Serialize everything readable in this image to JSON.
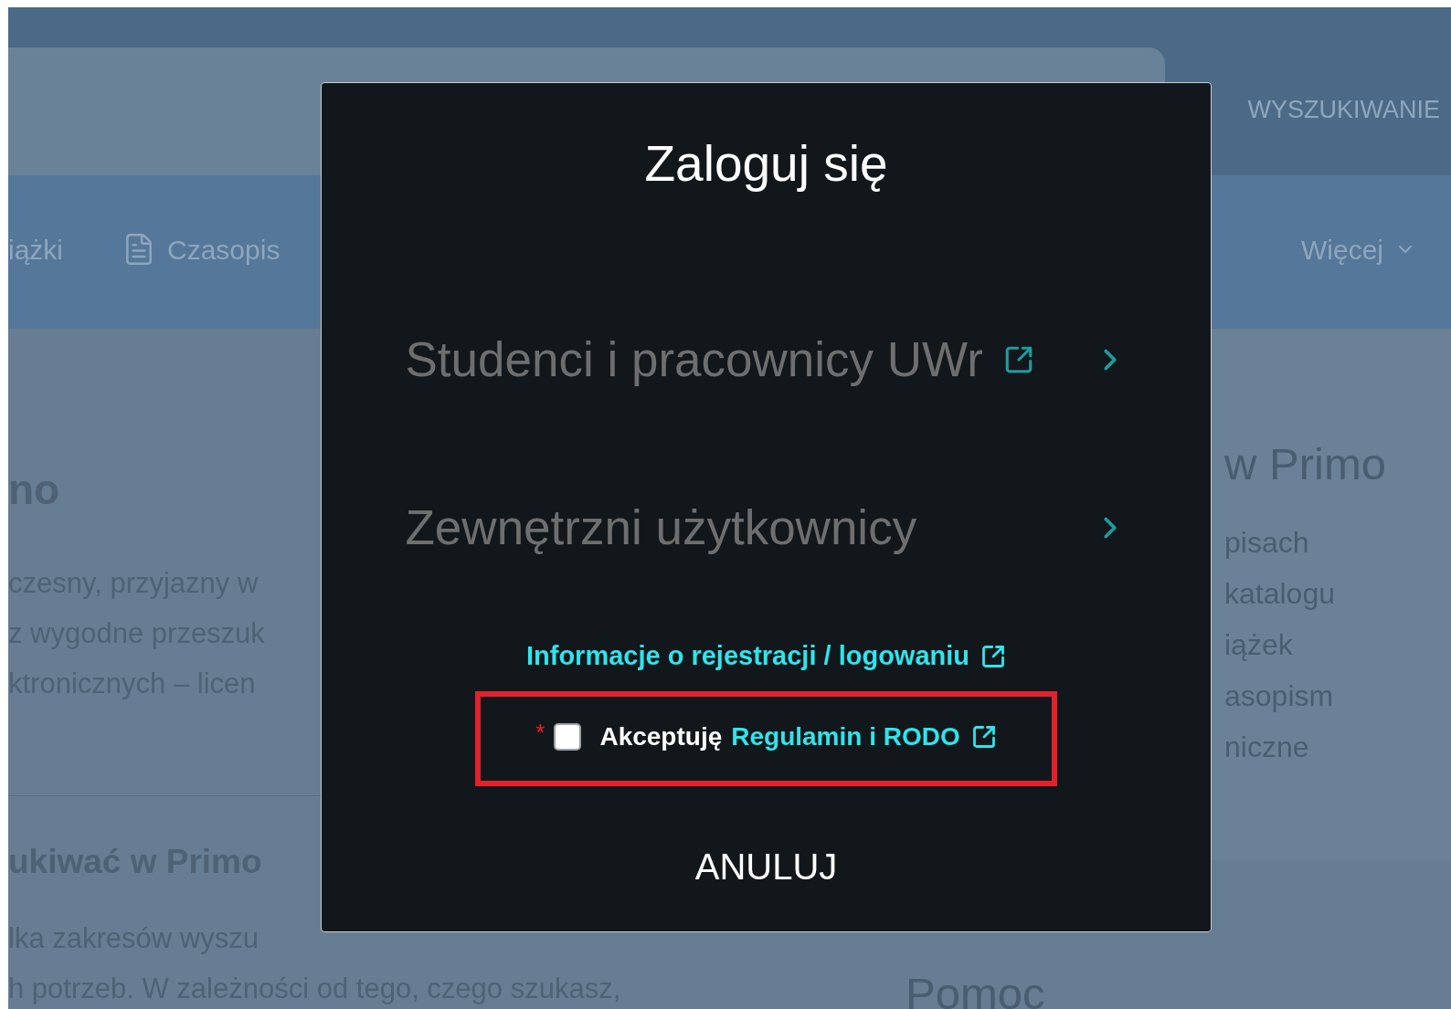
{
  "header": {
    "nav_link": "WYSZUKIWANIE"
  },
  "nav": [
    {
      "label": "iążki",
      "kind": "plain"
    },
    {
      "label": "Czasopis",
      "kind": "journal"
    },
    {
      "label": "Więcej",
      "kind": "more"
    }
  ],
  "intro": {
    "heading": "no",
    "lines": [
      "czesny, przyjazny w",
      "z wygodne przeszuk",
      "ktronicznych – licen"
    ]
  },
  "search_help": {
    "heading": "ukiwać w Primo",
    "lines": [
      "lka zakresów wyszu",
      "h potrzeb. W zależności od tego, czego szukasz,"
    ]
  },
  "sidebar": {
    "heading": "w Primo",
    "items": [
      "pisach",
      "katalogu",
      "iążek",
      "asopism",
      "niczne"
    ]
  },
  "help": {
    "heading": "Pomoc"
  },
  "dialog": {
    "title": "Zaloguj się",
    "options": [
      {
        "label": "Studenci i pracownicy UWr",
        "external": true
      },
      {
        "label": "Zewnętrzni użytkownicy",
        "external": false
      }
    ],
    "info_link": "Informacje o rejestracji / logowaniu",
    "consent": {
      "required_mark": "*",
      "checked": false,
      "text": "Akceptuję",
      "link": "Regulamin i RODO"
    },
    "cancel": "ANULUJ"
  }
}
